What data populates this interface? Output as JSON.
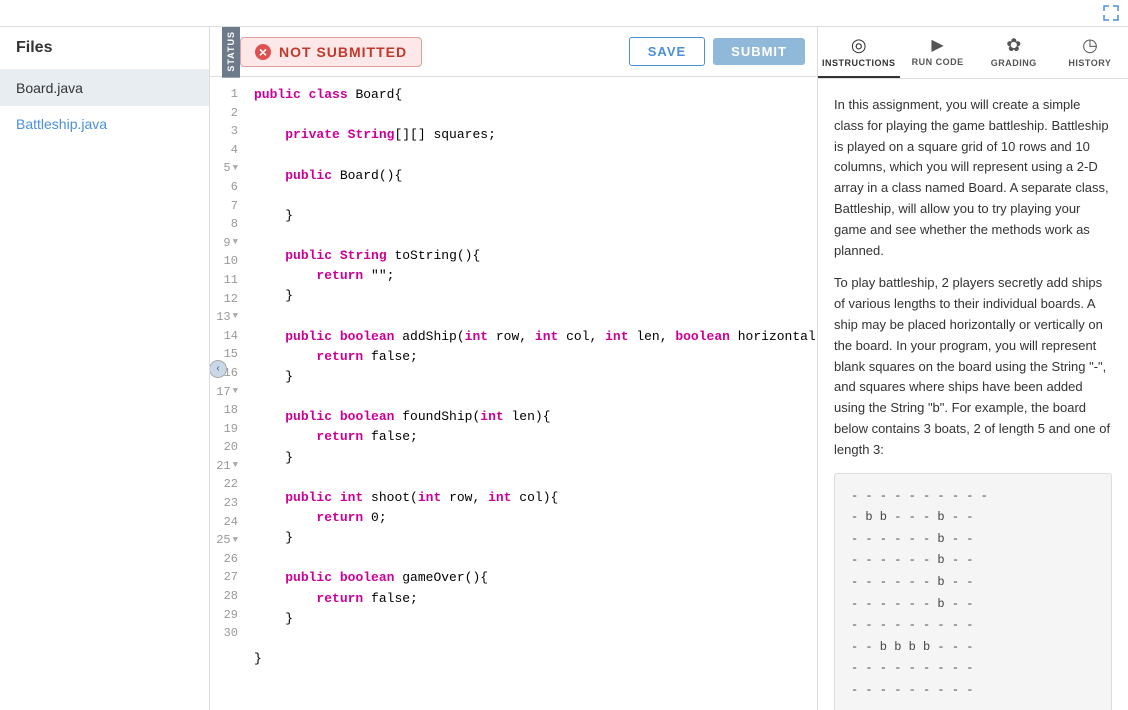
{
  "topbar": {
    "expand_icon": "⤢"
  },
  "files": {
    "header": "Files",
    "items": [
      {
        "name": "Board.java",
        "active": true
      },
      {
        "name": "Battleship.java",
        "active": false,
        "highlight": true
      }
    ]
  },
  "editor": {
    "status_label": "STATUS",
    "not_submitted_label": "NOT SUBMITTED",
    "save_label": "SAVE",
    "submit_label": "SUBMIT",
    "code_lines": [
      {
        "num": 1,
        "has_arrow": false,
        "content": "public class Board{"
      },
      {
        "num": 2,
        "has_arrow": false,
        "content": ""
      },
      {
        "num": 3,
        "has_arrow": false,
        "content": "    private String[][] squares;"
      },
      {
        "num": 4,
        "has_arrow": false,
        "content": ""
      },
      {
        "num": 5,
        "has_arrow": true,
        "content": "    public Board(){"
      },
      {
        "num": 6,
        "has_arrow": false,
        "content": ""
      },
      {
        "num": 7,
        "has_arrow": false,
        "content": "    }"
      },
      {
        "num": 8,
        "has_arrow": false,
        "content": ""
      },
      {
        "num": 9,
        "has_arrow": true,
        "content": "    public String toString(){"
      },
      {
        "num": 10,
        "has_arrow": false,
        "content": "        return \"\";"
      },
      {
        "num": 11,
        "has_arrow": false,
        "content": "    }"
      },
      {
        "num": 12,
        "has_arrow": false,
        "content": ""
      },
      {
        "num": 13,
        "has_arrow": true,
        "content": "    public boolean addShip(int row, int col, int len, boolean horizontal){"
      },
      {
        "num": 14,
        "has_arrow": false,
        "content": "        return false;"
      },
      {
        "num": 15,
        "has_arrow": false,
        "content": "    }"
      },
      {
        "num": 16,
        "has_arrow": false,
        "content": ""
      },
      {
        "num": 17,
        "has_arrow": true,
        "content": "    public boolean foundShip(int len){"
      },
      {
        "num": 18,
        "has_arrow": false,
        "content": "        return false;"
      },
      {
        "num": 19,
        "has_arrow": false,
        "content": "    }"
      },
      {
        "num": 20,
        "has_arrow": false,
        "content": ""
      },
      {
        "num": 21,
        "has_arrow": true,
        "content": "    public int shoot(int row, int col){"
      },
      {
        "num": 22,
        "has_arrow": false,
        "content": "        return 0;"
      },
      {
        "num": 23,
        "has_arrow": false,
        "content": "    }"
      },
      {
        "num": 24,
        "has_arrow": false,
        "content": ""
      },
      {
        "num": 25,
        "has_arrow": true,
        "content": "    public boolean gameOver(){"
      },
      {
        "num": 26,
        "has_arrow": false,
        "content": "        return false;"
      },
      {
        "num": 27,
        "has_arrow": false,
        "content": "    }"
      },
      {
        "num": 28,
        "has_arrow": false,
        "content": ""
      },
      {
        "num": 29,
        "has_arrow": false,
        "content": "}"
      },
      {
        "num": 30,
        "has_arrow": false,
        "content": ""
      }
    ]
  },
  "instructions_panel": {
    "tabs": [
      {
        "id": "instructions",
        "icon": "◎",
        "label": "INSTRUCTIONS",
        "active": true
      },
      {
        "id": "run_code",
        "icon": "▷",
        "label": "RUN CODE",
        "active": false
      },
      {
        "id": "grading",
        "icon": "✿",
        "label": "GRADING",
        "active": false
      },
      {
        "id": "history",
        "icon": "◷",
        "label": "HISTORY",
        "active": false
      }
    ],
    "content": {
      "paragraph1": "In this assignment, you will create a simple class for playing the game battleship. Battleship is played on a square grid of 10 rows and 10 columns, which you will represent using a 2-D array in a class named Board. A separate class, Battleship, will allow you to try playing your game and see whether the methods work as planned.",
      "paragraph2": "To play battleship, 2 players secretly add ships of various lengths to their individual boards. A ship may be placed horizontally or vertically on the board. In your program, you will represent blank squares on the board using the String \"-\", and squares where ships have been added using the String \"b\". For example, the board below contains 3 boats, 2 of length 5 and one of length 3:",
      "grid_rows": [
        "- - - - - - - - - -",
        "- b b - - - b - -",
        "- - - - - - b - -",
        "- - - - - - b - -",
        "- - - - - - b - -",
        "- - - - - - b - -",
        "- - - - - - - - -",
        "- - b b b b - - -",
        "- - - - - - - - -",
        "- - - - - - - - -"
      ]
    }
  }
}
